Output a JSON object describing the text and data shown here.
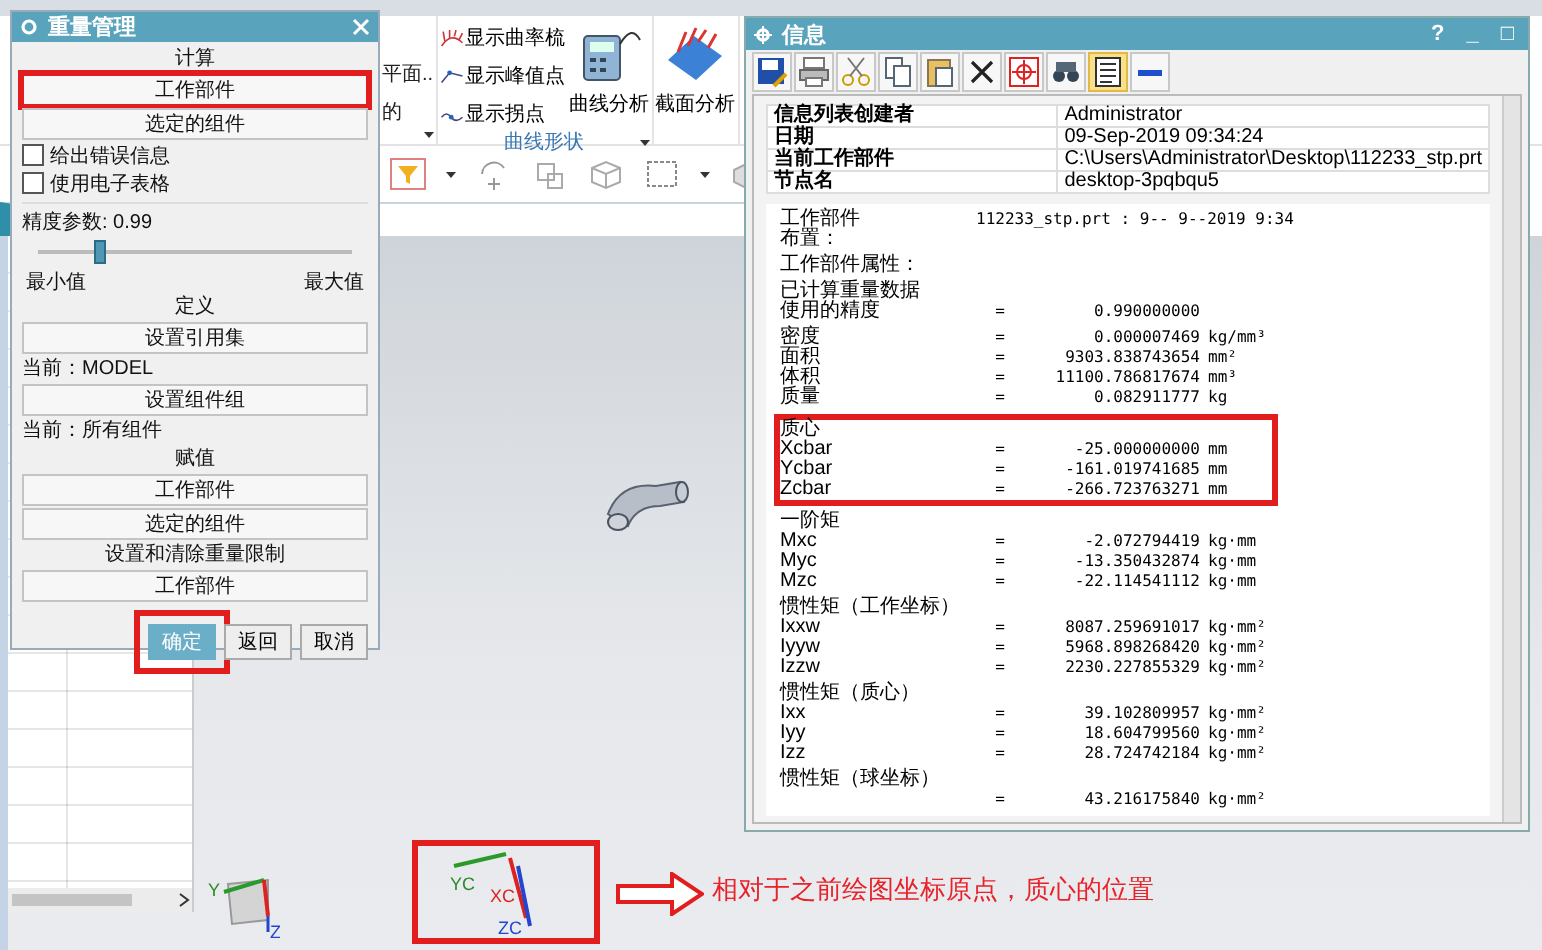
{
  "ribbon": {
    "left_items": [
      {
        "label": "平面.."
      },
      {
        "label": "的"
      }
    ],
    "curve_items": [
      {
        "kind": "comb",
        "label": "显示曲率梳"
      },
      {
        "kind": "peak",
        "label": "显示峰值点"
      },
      {
        "kind": "inflection",
        "label": "显示拐点"
      }
    ],
    "large_buttons": [
      {
        "kind": "curve-analysis",
        "label": "曲线分析"
      },
      {
        "kind": "section-analysis",
        "label": "截面分析"
      }
    ],
    "group_label": "曲线形状"
  },
  "weight_dialog": {
    "title": "重量管理",
    "items": [
      {
        "kind": "heading",
        "text": "计算"
      },
      {
        "kind": "button",
        "label": "工作部件",
        "highlighted": true
      },
      {
        "kind": "button",
        "label": "选定的组件",
        "highlighted": false
      },
      {
        "kind": "checkbox",
        "label": "给出错误信息",
        "checked": false
      },
      {
        "kind": "checkbox",
        "label": "使用电子表格",
        "checked": false
      },
      {
        "kind": "slider",
        "label": "精度参数: 0.99",
        "level": 0.2,
        "min_label": "最小值",
        "max_label": "最大值"
      },
      {
        "kind": "heading",
        "text": "定义"
      },
      {
        "kind": "button",
        "label": "设置引用集",
        "highlighted": false
      },
      {
        "kind": "note",
        "text": "当前：MODEL"
      },
      {
        "kind": "button",
        "label": "设置组件组",
        "highlighted": false
      },
      {
        "kind": "note",
        "text": "当前：所有组件"
      },
      {
        "kind": "heading",
        "text": "赋值"
      },
      {
        "kind": "button",
        "label": "工作部件",
        "highlighted": false
      },
      {
        "kind": "button",
        "label": "选定的组件",
        "highlighted": false
      },
      {
        "kind": "heading",
        "text": "设置和清除重量限制"
      },
      {
        "kind": "button",
        "label": "工作部件",
        "highlighted": false
      }
    ],
    "footer_buttons": [
      {
        "label": "确定",
        "primary": true,
        "highlighted": true
      },
      {
        "label": "返回",
        "primary": false,
        "highlighted": false
      },
      {
        "label": "取消",
        "primary": false,
        "highlighted": false
      }
    ]
  },
  "info_window": {
    "title": "信息",
    "title_buttons": [
      "?",
      "_",
      "□"
    ],
    "toolbar": [
      {
        "kind": "save",
        "selected": false
      },
      {
        "kind": "print",
        "selected": false
      },
      {
        "kind": "cut",
        "selected": false
      },
      {
        "kind": "copy",
        "selected": false
      },
      {
        "kind": "paste",
        "selected": false
      },
      {
        "kind": "delete",
        "selected": false
      },
      {
        "kind": "target",
        "selected": false
      },
      {
        "kind": "binoculars",
        "selected": false
      },
      {
        "kind": "list",
        "selected": true
      },
      {
        "kind": "minus",
        "selected": false
      }
    ],
    "header_table": [
      {
        "label": "信息列表创建者",
        "value": "Administrator"
      },
      {
        "label": "日期",
        "value": "09-Sep-2019 09:34:24"
      },
      {
        "label": "当前工作部件",
        "value": "C:\\Users\\Administrator\\Desktop\\112233_stp.prt"
      },
      {
        "label": "节点名",
        "value": "desktop-3pqbqu5"
      }
    ],
    "report": [
      {
        "highlighted": false,
        "rows": [
          {
            "name": "工作部件",
            "value": "112233_stp.prt :  9-- 9--2019  9:34"
          },
          {
            "name": "布置："
          }
        ]
      },
      {
        "highlighted": false,
        "rows": [
          {
            "name": "工作部件属性："
          }
        ]
      },
      {
        "highlighted": false,
        "rows": [
          {
            "name": "已计算重量数据"
          },
          {
            "name": "使用的精度",
            "sign": "=",
            "value": "0.990000000"
          }
        ]
      },
      {
        "highlighted": false,
        "rows": [
          {
            "name": "密度",
            "sign": "=",
            "value": "0.000007469",
            "unit": "kg/mm³"
          },
          {
            "name": "面积",
            "sign": "=",
            "value": "9303.838743654",
            "unit": "mm²"
          },
          {
            "name": "体积",
            "sign": "=",
            "value": "11100.786817674",
            "unit": "mm³"
          },
          {
            "name": "质量",
            "sign": "=",
            "value": "0.082911777",
            "unit": "kg"
          }
        ]
      },
      {
        "highlighted": true,
        "rows": [
          {
            "name": "质心"
          },
          {
            "name": "Xcbar",
            "sign": "=",
            "value": "-25.000000000",
            "unit": "mm"
          },
          {
            "name": "Ycbar",
            "sign": "=",
            "value": "-161.019741685",
            "unit": "mm"
          },
          {
            "name": "Zcbar",
            "sign": "=",
            "value": "-266.723763271",
            "unit": "mm"
          }
        ]
      },
      {
        "highlighted": false,
        "rows": [
          {
            "name": "一阶矩"
          },
          {
            "name": "Mxc",
            "sign": "=",
            "value": "-2.072794419",
            "unit": "kg·mm"
          },
          {
            "name": "Myc",
            "sign": "=",
            "value": "-13.350432874",
            "unit": "kg·mm"
          },
          {
            "name": "Mzc",
            "sign": "=",
            "value": "-22.114541112",
            "unit": "kg·mm"
          }
        ]
      },
      {
        "highlighted": false,
        "rows": [
          {
            "name": "惯性矩（工作坐标）"
          },
          {
            "name": "Ixxw",
            "sign": "=",
            "value": "8087.259691017",
            "unit": "kg·mm²"
          },
          {
            "name": "Iyyw",
            "sign": "=",
            "value": "5968.898268420",
            "unit": "kg·mm²"
          },
          {
            "name": "Izzw",
            "sign": "=",
            "value": "2230.227855329",
            "unit": "kg·mm²"
          }
        ]
      },
      {
        "highlighted": false,
        "rows": [
          {
            "name": "惯性矩（质心）"
          },
          {
            "name": "Ixx",
            "sign": "=",
            "value": "39.102809957",
            "unit": "kg·mm²"
          },
          {
            "name": "Iyy",
            "sign": "=",
            "value": "18.604799560",
            "unit": "kg·mm²"
          },
          {
            "name": "Izz",
            "sign": "=",
            "value": "28.724742184",
            "unit": "kg·mm²"
          }
        ]
      },
      {
        "highlighted": false,
        "rows": [
          {
            "name": "惯性矩（球坐标）"
          },
          {
            "sign": "=",
            "value": "43.216175840",
            "unit": "kg·mm²"
          }
        ]
      }
    ]
  },
  "viewport": {
    "triad_labels": [
      "Y",
      "Z"
    ],
    "highlight_triad": {
      "labels": [
        "YC",
        "XC",
        "ZC"
      ],
      "highlighted": true
    },
    "annotation": "相对于之前绘图坐标原点，质心的位置"
  }
}
